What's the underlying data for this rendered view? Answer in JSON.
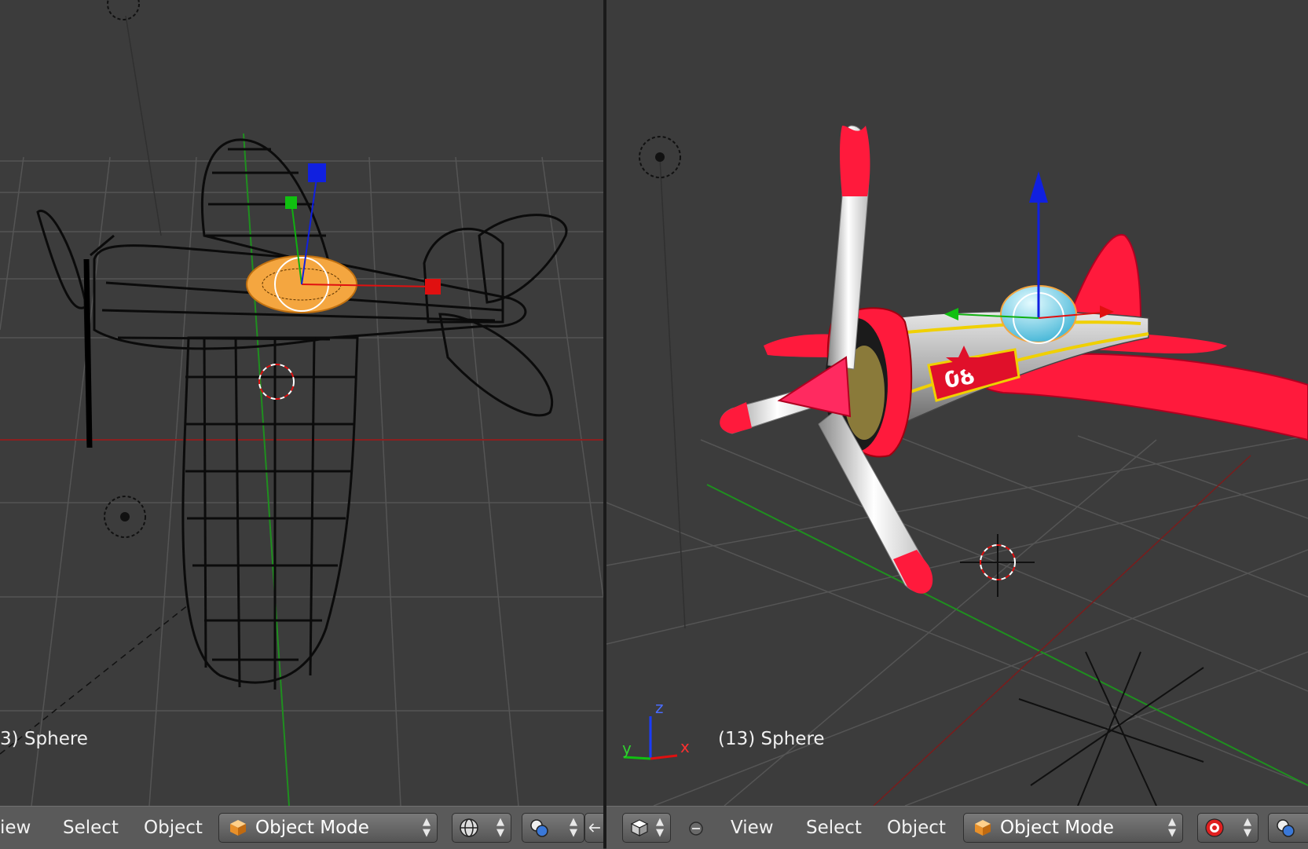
{
  "left_viewport": {
    "object_label": "3) Sphere"
  },
  "right_viewport": {
    "object_label": "(13) Sphere",
    "axis_labels": {
      "z": "z",
      "y": "y",
      "x": "x"
    },
    "fuselage_number": "08"
  },
  "left_header": {
    "menu_view": "iew",
    "menu_select": "Select",
    "menu_object": "Object",
    "mode_label": "Object Mode"
  },
  "right_header": {
    "menu_view": "View",
    "menu_select": "Select",
    "menu_object": "Object",
    "mode_label": "Object Mode"
  },
  "colors": {
    "viewport_bg": "#3c3c3c",
    "header_bg": "#5a5a5a",
    "selection_orange": "#f4a640",
    "x_axis": "#d40000",
    "y_axis": "#00b400",
    "z_axis": "#0000dd",
    "plane_red": "#ff1a3c"
  },
  "icons": [
    "cube-icon",
    "viewport-shading-icon",
    "pivot-icon",
    "manipulator-icon",
    "view-cube-icon",
    "circle-icon",
    "proportional-icon"
  ]
}
